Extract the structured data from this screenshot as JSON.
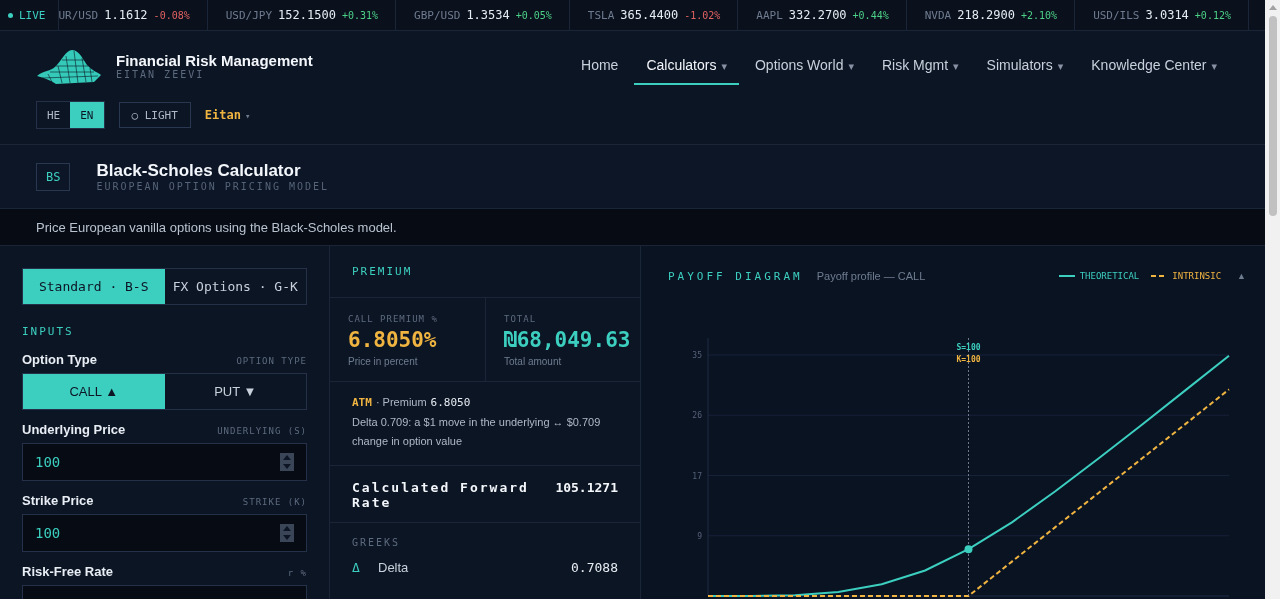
{
  "ticker": {
    "live_label": "LIVE",
    "items": [
      {
        "symbol": "UR/USD",
        "price": "1.1612",
        "change": "-0.08%",
        "color": "#e26161"
      },
      {
        "symbol": "USD/JPY",
        "price": "152.1500",
        "change": "+0.31%",
        "color": "#4ccf86"
      },
      {
        "symbol": "GBP/USD",
        "price": "1.3534",
        "change": "+0.05%",
        "color": "#4ccf86"
      },
      {
        "symbol": "TSLA",
        "price": "365.4400",
        "change": "-1.02%",
        "color": "#e26161"
      },
      {
        "symbol": "AAPL",
        "price": "332.2700",
        "change": "+0.44%",
        "color": "#4ccf86"
      },
      {
        "symbol": "NVDA",
        "price": "218.2900",
        "change": "+2.10%",
        "color": "#4ccf86"
      },
      {
        "symbol": "USD/ILS",
        "price": "3.0314",
        "change": "+0.12%",
        "color": "#4ccf86"
      }
    ]
  },
  "header": {
    "brand": "Financial Risk Management",
    "author": "EITAN ZEEVI",
    "nav": [
      {
        "label": "Home",
        "selected": false
      },
      {
        "label": "Calculators",
        "caret": "▾",
        "selected": true
      },
      {
        "label": "Options World",
        "caret": "▾",
        "selected": false
      },
      {
        "label": "Risk Mgmt",
        "caret": "▾",
        "selected": false
      },
      {
        "label": "Simulators",
        "caret": "▾",
        "selected": false
      },
      {
        "label": "Knowledge Center",
        "caret": "▾",
        "selected": false
      }
    ],
    "languages": [
      {
        "label": "HE",
        "selected": false
      },
      {
        "label": "EN",
        "selected": true
      }
    ],
    "theme_button": "○ LIGHT",
    "user": "Eitan",
    "user_caret": "▾"
  },
  "page": {
    "badge": "BS",
    "title": "Black-Scholes Calculator",
    "subtitle": "EUROPEAN OPTION PRICING MODEL",
    "description": "Price European vanilla options using the Black-Scholes model."
  },
  "inputs": {
    "models": [
      {
        "label": "Standard · B-S",
        "selected": true
      },
      {
        "label": "FX Options · G-K",
        "selected": false
      }
    ],
    "heading": "INPUTS",
    "fields": [
      {
        "kind": "toggle",
        "label": "Option Type",
        "hint": "OPTION TYPE",
        "options": [
          {
            "label": "CALL ▲",
            "selected": true
          },
          {
            "label": "PUT ▼",
            "selected": false
          }
        ]
      },
      {
        "kind": "number",
        "label": "Underlying Price",
        "hint": "UNDERLYING (S)",
        "value": "100"
      },
      {
        "kind": "number",
        "label": "Strike Price",
        "hint": "STRIKE (K)",
        "value": "100"
      },
      {
        "kind": "number",
        "label": "Risk-Free Rate",
        "hint": "r %"
      }
    ]
  },
  "premium": {
    "heading": "PREMIUM",
    "stats": [
      {
        "label": "CALL PREMIUM %",
        "value": "6.8050%",
        "caption": "Price in percent",
        "color": "#f0b441"
      },
      {
        "label": "TOTAL",
        "value": "₪68,049.63",
        "caption": "Total amount",
        "color": "#3ccfc0"
      }
    ],
    "moneyness": "ATM",
    "premium_note": "· Premium",
    "premium_value": "6.8050",
    "delta_note": "Delta 0.709: a $1 move in the underlying ↔ $0.709 change in option value",
    "forward_label": "Calculated Forward Rate",
    "forward_value": "105.1271",
    "greeks_heading": "GREEKS",
    "greeks": [
      {
        "symbol": "Δ",
        "name": "Delta",
        "value": "0.7088"
      }
    ]
  },
  "payoff": {
    "heading": "PAYOFF DIAGRAM",
    "subtitle": "Payoff profile — CALL",
    "collapse": "▲",
    "markers": [
      {
        "text": "S=100"
      },
      {
        "text": "K=100"
      }
    ],
    "chart_data": {
      "type": "line",
      "categories": [
        null,
        null,
        null,
        null,
        null,
        null,
        null,
        null,
        null,
        null,
        null,
        null,
        null
      ],
      "series": [
        {
          "name": "THEORETICAL",
          "color": "#3ccfc0",
          "line_style": "solid",
          "values": [
            0,
            0,
            0.1,
            0.6,
            1.7,
            3.7,
            6.8,
            10.7,
            15.2,
            20,
            24.9,
            29.9,
            34.9
          ]
        },
        {
          "name": "INTRINSIC",
          "color": "#f0b441",
          "line_style": "dashed",
          "values": [
            0,
            0,
            0,
            0,
            0,
            0,
            0,
            5,
            10,
            15,
            20,
            25,
            30
          ]
        }
      ],
      "ylim": [
        0,
        35
      ],
      "grid": true,
      "yticks": [
        {
          "value": 8.75,
          "label": "9"
        },
        {
          "value": 17.5,
          "label": "17"
        },
        {
          "value": 26.25,
          "label": "26"
        },
        {
          "value": 35,
          "label": "35"
        }
      ]
    }
  }
}
